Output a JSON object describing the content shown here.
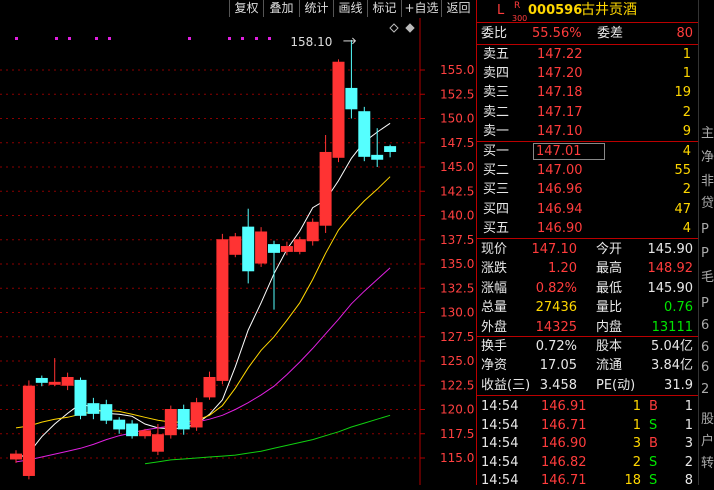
{
  "toolbar": {
    "buttons": [
      "复权",
      "叠加",
      "统计",
      "画线",
      "标记",
      "+自选",
      "返回"
    ]
  },
  "chart_data": {
    "type": "candlestick",
    "y_ticks": [
      "155.0",
      "152.5",
      "150.0",
      "147.5",
      "145.0",
      "142.5",
      "140.0",
      "137.5",
      "135.0",
      "132.5",
      "130.0",
      "127.5",
      "125.0",
      "122.5",
      "120.0",
      "117.5",
      "115.0"
    ],
    "ylim": [
      114.2,
      159.2
    ],
    "high_label": "158.10",
    "candles": [
      {
        "o": 114.9,
        "c": 115.4,
        "h": 115.8,
        "l": 114.5
      },
      {
        "o": 113.2,
        "c": 122.4,
        "h": 123.0,
        "l": 112.8
      },
      {
        "o": 123.2,
        "c": 122.8,
        "h": 123.5,
        "l": 122.4
      },
      {
        "o": 122.6,
        "c": 122.8,
        "h": 125.3,
        "l": 122.4
      },
      {
        "o": 122.5,
        "c": 123.3,
        "h": 123.8,
        "l": 122.0
      },
      {
        "o": 123.0,
        "c": 119.4,
        "h": 123.3,
        "l": 119.0
      },
      {
        "o": 120.6,
        "c": 119.6,
        "h": 121.2,
        "l": 119.0
      },
      {
        "o": 120.5,
        "c": 118.9,
        "h": 121.0,
        "l": 118.5
      },
      {
        "o": 118.9,
        "c": 118.0,
        "h": 119.2,
        "l": 117.5
      },
      {
        "o": 118.5,
        "c": 117.3,
        "h": 118.9,
        "l": 117.0
      },
      {
        "o": 117.3,
        "c": 117.8,
        "h": 118.0,
        "l": 117.0
      },
      {
        "o": 115.7,
        "c": 117.4,
        "h": 118.5,
        "l": 115.3
      },
      {
        "o": 117.4,
        "c": 120.0,
        "h": 120.4,
        "l": 117.0
      },
      {
        "o": 120.0,
        "c": 118.0,
        "h": 120.5,
        "l": 117.4
      },
      {
        "o": 118.2,
        "c": 120.7,
        "h": 121.2,
        "l": 117.8
      },
      {
        "o": 121.3,
        "c": 123.3,
        "h": 123.9,
        "l": 121.0
      },
      {
        "o": 123.0,
        "c": 137.5,
        "h": 138.1,
        "l": 122.6
      },
      {
        "o": 136.0,
        "c": 137.8,
        "h": 138.2,
        "l": 135.7
      },
      {
        "o": 138.8,
        "c": 134.3,
        "h": 140.7,
        "l": 133.0
      },
      {
        "o": 135.1,
        "c": 138.3,
        "h": 138.8,
        "l": 134.7
      },
      {
        "o": 137.0,
        "c": 136.2,
        "h": 137.4,
        "l": 130.3
      },
      {
        "o": 136.3,
        "c": 136.8,
        "h": 137.3,
        "l": 135.9
      },
      {
        "o": 136.3,
        "c": 137.5,
        "h": 137.8,
        "l": 136.0
      },
      {
        "o": 137.4,
        "c": 139.3,
        "h": 139.7,
        "l": 136.9
      },
      {
        "o": 139.0,
        "c": 146.5,
        "h": 148.3,
        "l": 138.2
      },
      {
        "o": 146.0,
        "c": 155.8,
        "h": 156.1,
        "l": 145.5
      },
      {
        "o": 153.1,
        "c": 151.0,
        "h": 158.1,
        "l": 150.0
      },
      {
        "o": 150.7,
        "c": 146.1,
        "h": 151.2,
        "l": 145.6
      },
      {
        "o": 146.2,
        "c": 145.8,
        "h": 149.0,
        "l": 145.0
      },
      {
        "o": 147.1,
        "c": 146.6,
        "h": 147.3,
        "l": 146.0
      }
    ],
    "ma_lines": [
      {
        "color": "#ffffff",
        "values": [
          114.9,
          115.5,
          117.2,
          118.5,
          119.6,
          120.6,
          120.2,
          119.6,
          119.5,
          119.3,
          118.5,
          118.1,
          118.0,
          118.1,
          118.5,
          119.5,
          121.0,
          124.4,
          128.2,
          131.0,
          134.0,
          136.5,
          138.4,
          140.8,
          141.6,
          143.6,
          145.9,
          147.6,
          148.6,
          149.5
        ]
      },
      {
        "color": "#ffd700",
        "values": [
          118.1,
          118.3,
          118.7,
          119.0,
          119.2,
          119.5,
          119.8,
          119.9,
          119.8,
          119.5,
          119.2,
          118.9,
          118.7,
          118.7,
          118.9,
          119.4,
          120.4,
          122.2,
          124.3,
          126.1,
          127.5,
          129.2,
          131.0,
          133.4,
          136.1,
          138.5,
          140.1,
          141.5,
          142.7,
          144.0
        ]
      },
      {
        "color": "#e020e0",
        "values": [
          114.6,
          114.8,
          115.1,
          115.4,
          115.7,
          116.0,
          116.4,
          116.9,
          117.3,
          117.6,
          117.9,
          118.1,
          118.3,
          118.5,
          118.7,
          119.0,
          119.4,
          120.0,
          120.7,
          121.5,
          122.4,
          123.6,
          124.9,
          126.3,
          127.8,
          129.3,
          130.9,
          132.2,
          133.4,
          134.6
        ]
      },
      {
        "color": "#10d010",
        "values": [
          null,
          null,
          null,
          null,
          null,
          null,
          null,
          null,
          null,
          null,
          114.4,
          114.6,
          114.8,
          114.9,
          115.0,
          115.1,
          115.2,
          115.3,
          115.5,
          115.7,
          116.0,
          116.3,
          116.6,
          116.9,
          117.3,
          117.7,
          118.2,
          118.6,
          119.0,
          119.4
        ]
      }
    ]
  },
  "quote": {
    "tag_l": "L",
    "tag_r": "R",
    "tag_300": "300",
    "code": "000596",
    "name": "古井贡酒",
    "weibi_label": "委比",
    "weibi_value": "55.56%",
    "weicha_label": "委差",
    "weicha_value": "80",
    "asks": [
      {
        "label": "卖五",
        "price": "147.22",
        "vol": "1"
      },
      {
        "label": "卖四",
        "price": "147.20",
        "vol": "1"
      },
      {
        "label": "卖三",
        "price": "147.18",
        "vol": "19"
      },
      {
        "label": "卖二",
        "price": "147.17",
        "vol": "2"
      },
      {
        "label": "卖一",
        "price": "147.10",
        "vol": "9"
      }
    ],
    "bids": [
      {
        "label": "买一",
        "price": "147.01",
        "vol": "4"
      },
      {
        "label": "买二",
        "price": "147.00",
        "vol": "55"
      },
      {
        "label": "买三",
        "price": "146.96",
        "vol": "2"
      },
      {
        "label": "买四",
        "price": "146.94",
        "vol": "47"
      },
      {
        "label": "买五",
        "price": "146.90",
        "vol": "4"
      }
    ],
    "stats": [
      {
        "l1": "现价",
        "v1": "147.10",
        "c1": "red",
        "l2": "今开",
        "v2": "145.90",
        "c2": "white"
      },
      {
        "l1": "涨跌",
        "v1": "1.20",
        "c1": "red",
        "l2": "最高",
        "v2": "148.92",
        "c2": "red"
      },
      {
        "l1": "涨幅",
        "v1": "0.82%",
        "c1": "red",
        "l2": "最低",
        "v2": "145.90",
        "c2": "white"
      },
      {
        "l1": "总量",
        "v1": "27436",
        "c1": "yellow",
        "l2": "量比",
        "v2": "0.76",
        "c2": "green"
      },
      {
        "l1": "外盘",
        "v1": "14325",
        "c1": "red",
        "l2": "内盘",
        "v2": "13111",
        "c2": "green"
      }
    ],
    "fin": [
      {
        "l1": "换手",
        "v1": "0.72%",
        "l2": "股本",
        "v2": "5.04亿"
      },
      {
        "l1": "净资",
        "v1": "17.05",
        "l2": "流通",
        "v2": "3.84亿"
      },
      {
        "l1": "收益(三)",
        "v1": "3.458",
        "l2": "PE(动)",
        "v2": "31.9"
      }
    ],
    "ticks": [
      {
        "time": "14:54",
        "price": "146.91",
        "pc": "red",
        "vol": "1",
        "vc": "yellow",
        "side": "B",
        "sc": "red",
        "n": "1"
      },
      {
        "time": "14:54",
        "price": "146.71",
        "pc": "red",
        "vol": "1",
        "vc": "yellow",
        "side": "S",
        "sc": "green",
        "n": "1"
      },
      {
        "time": "14:54",
        "price": "146.90",
        "pc": "red",
        "vol": "3",
        "vc": "yellow",
        "side": "B",
        "sc": "red",
        "n": "3"
      },
      {
        "time": "14:54",
        "price": "146.82",
        "pc": "red",
        "vol": "2",
        "vc": "yellow",
        "side": "S",
        "sc": "green",
        "n": "2"
      },
      {
        "time": "14:54",
        "price": "146.71",
        "pc": "red",
        "vol": "18",
        "vc": "yellow",
        "side": "S",
        "sc": "green",
        "n": "8"
      }
    ]
  },
  "edge_glyphs": [
    "主",
    "净",
    "非",
    "贷",
    "P",
    "P",
    "毛",
    "P",
    "6",
    "6",
    "6",
    "2",
    "股",
    "户",
    "转"
  ],
  "colors": {
    "up": "#ff3333",
    "down": "#55ffff",
    "grid": "#8b0000",
    "axis": "#b00000",
    "label": "#ff4040"
  }
}
